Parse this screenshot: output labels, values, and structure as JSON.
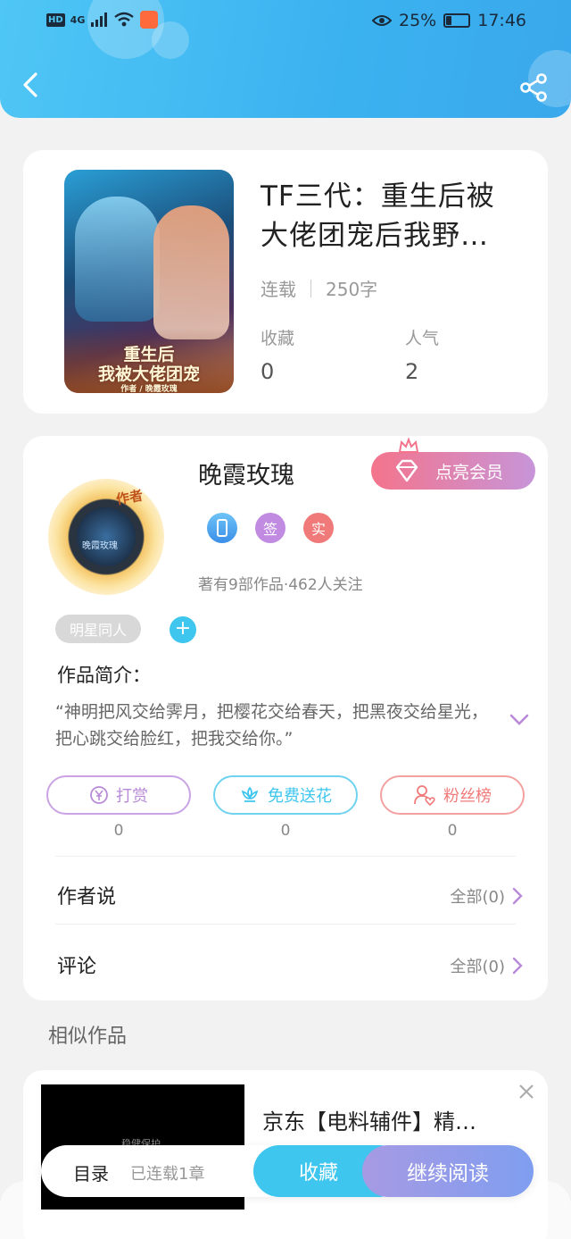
{
  "status_bar": {
    "hd": "HD",
    "network": "4G",
    "battery_percent": "25%",
    "time": "17:46",
    "battery_level": 0.25
  },
  "book": {
    "title": "TF三代：重生后被大佬团宠后我野…",
    "status": "连载",
    "word_count": "250字",
    "favorites_label": "收藏",
    "favorites_value": "0",
    "popularity_label": "人气",
    "popularity_value": "2",
    "cover_title_1": "重生后",
    "cover_title_2": "我被大佬团宠",
    "cover_author": "作者 / 晚霞玫瑰"
  },
  "author": {
    "name": "晚霞玫瑰",
    "avatar_tag": "作者",
    "avatar_name": "晚霞玫瑰",
    "vip_label": "点亮会员",
    "badge_sign": "签",
    "badge_real": "实",
    "works_info": "著有9部作品·462人关注",
    "genre_tag": "明星同人",
    "add_tag": "+",
    "intro_heading": "作品简介：",
    "intro_text": "“神明把风交给霁月，把樱花交给春天，把黑夜交给星光，把心跳交给脸红，把我交给你。”"
  },
  "actions": {
    "tip_label": "打赏",
    "tip_count": "0",
    "flower_label": "免费送花",
    "flower_count": "0",
    "fans_label": "粉丝榜",
    "fans_count": "0"
  },
  "sections": {
    "author_says": "作者说",
    "author_says_all": "全部(0)",
    "comments": "评论",
    "comments_all": "全部(0)"
  },
  "similar": {
    "heading": "相似作品",
    "item_title": "京东【电料辅件】精…",
    "thumb_text": "稳健保护"
  },
  "bottom_bar": {
    "toc": "目录",
    "chapters": "已连载1章",
    "favorite": "收藏",
    "continue_reading": "继续阅读"
  },
  "colors": {
    "header_blue": "#3bb2f0",
    "accent_cyan": "#3ec6ee",
    "tip_purple": "#b98ad8",
    "flower_cyan": "#3ec6ee",
    "fans_red": "#f07a7a"
  }
}
